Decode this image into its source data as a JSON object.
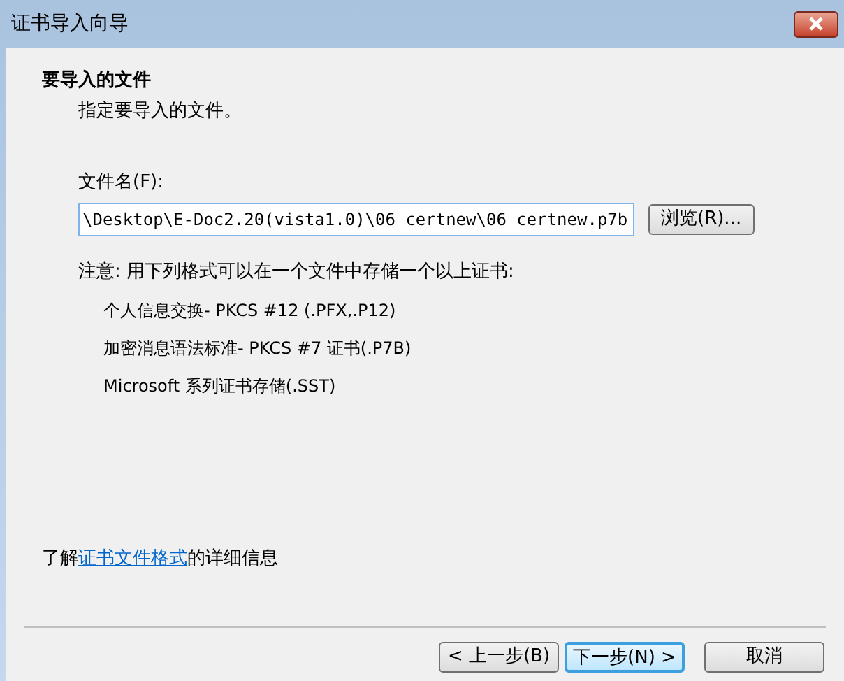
{
  "window": {
    "title": "证书导入向导"
  },
  "header": {
    "title": "要导入的文件",
    "subtitle": "指定要导入的文件。"
  },
  "file_field": {
    "label": "文件名(F):",
    "value": "\\Desktop\\E-Doc2.20(vista1.0)\\06 certnew\\06 certnew.p7b"
  },
  "browse_button": "浏览(R)...",
  "note": "注意: 用下列格式可以在一个文件中存储一个以上证书:",
  "formats": [
    "个人信息交换- PKCS #12 (.PFX,.P12)",
    "加密消息语法标准- PKCS #7 证书(.P7B)",
    "Microsoft 系列证书存储(.SST)"
  ],
  "info": {
    "before": "了解",
    "link": "证书文件格式",
    "after": "的详细信息"
  },
  "buttons": [
    {
      "label": "< 上一步(B)",
      "default": false
    },
    {
      "label": "下一步(N) >",
      "default": true
    },
    {
      "label": "取消",
      "default": false
    }
  ]
}
